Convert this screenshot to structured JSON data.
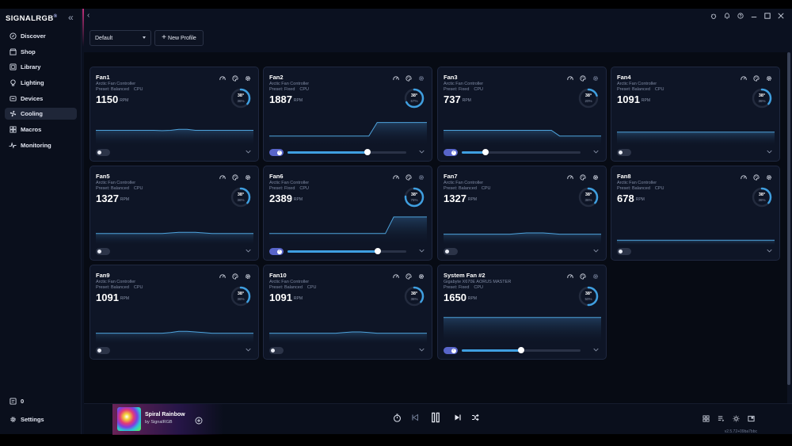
{
  "app": {
    "logo": "SIGNALRGB",
    "logo_mark": "®"
  },
  "sidebar": {
    "items": [
      {
        "label": "Discover",
        "icon": "compass-icon"
      },
      {
        "label": "Shop",
        "icon": "shop-icon"
      },
      {
        "label": "Library",
        "icon": "library-icon"
      },
      {
        "label": "Lighting",
        "icon": "lightbulb-icon"
      },
      {
        "label": "Devices",
        "icon": "devices-icon"
      },
      {
        "label": "Cooling",
        "icon": "fan-icon",
        "active": true
      },
      {
        "label": "Macros",
        "icon": "macros-icon"
      },
      {
        "label": "Monitoring",
        "icon": "pulse-icon"
      }
    ],
    "notifications_count": "0",
    "settings_label": "Settings"
  },
  "toolbar": {
    "profile_value": "Default",
    "new_profile_label": "New Profile"
  },
  "fans": [
    {
      "name": "Fan1",
      "controller": "Arctic Fan Controller",
      "preset": "Preset: Balanced",
      "source": "CPU",
      "rpm": "1150",
      "rpm_unit": "RPM",
      "temp": "38°",
      "percent": "36%",
      "percent_value": 36,
      "manual": false,
      "slider": null,
      "curve": [
        0.46,
        0.46,
        0.46,
        0.46,
        0.46,
        0.46,
        0.46,
        0.46,
        0.47,
        0.46,
        0.43,
        0.43,
        0.46,
        0.46,
        0.46,
        0.46,
        0.46,
        0.46,
        0.46,
        0.46
      ]
    },
    {
      "name": "Fan2",
      "controller": "Arctic Fan Controller",
      "preset": "Preset: Fixed",
      "source": "CPU",
      "rpm": "1887",
      "rpm_unit": "RPM",
      "temp": "38°",
      "percent": "67%",
      "percent_value": 67,
      "manual": true,
      "slider": 0.67,
      "curve": [
        0.65,
        0.65,
        0.65,
        0.65,
        0.65,
        0.65,
        0.65,
        0.65,
        0.65,
        0.65,
        0.65,
        0.65,
        0.65,
        0.2,
        0.2,
        0.2,
        0.2,
        0.2,
        0.2,
        0.2
      ]
    },
    {
      "name": "Fan3",
      "controller": "Arctic Fan Controller",
      "preset": "Preset: Fixed",
      "source": "CPU",
      "rpm": "737",
      "rpm_unit": "RPM",
      "temp": "38°",
      "percent": "20%",
      "percent_value": 20,
      "manual": true,
      "slider": 0.2,
      "curve": [
        0.46,
        0.46,
        0.46,
        0.46,
        0.46,
        0.46,
        0.46,
        0.46,
        0.46,
        0.46,
        0.46,
        0.46,
        0.46,
        0.46,
        0.65,
        0.65,
        0.65,
        0.65,
        0.65,
        0.65
      ]
    },
    {
      "name": "Fan4",
      "controller": "Arctic Fan Controller",
      "preset": "Preset: Balanced",
      "source": "CPU",
      "rpm": "1091",
      "rpm_unit": "RPM",
      "temp": "38°",
      "percent": "36%",
      "percent_value": 36,
      "manual": false,
      "slider": null,
      "curve": [
        0.52,
        0.52,
        0.52,
        0.52,
        0.52,
        0.52,
        0.52,
        0.52,
        0.52,
        0.52,
        0.52,
        0.52,
        0.52,
        0.52,
        0.52,
        0.52,
        0.52,
        0.52,
        0.52,
        0.52
      ]
    },
    {
      "name": "Fan5",
      "controller": "Arctic Fan Controller",
      "preset": "Preset: Balanced",
      "source": "CPU",
      "rpm": "1327",
      "rpm_unit": "RPM",
      "temp": "38°",
      "percent": "36%",
      "percent_value": 36,
      "manual": false,
      "slider": null,
      "curve": [
        0.6,
        0.6,
        0.6,
        0.6,
        0.6,
        0.6,
        0.6,
        0.6,
        0.6,
        0.58,
        0.56,
        0.56,
        0.56,
        0.58,
        0.6,
        0.6,
        0.6,
        0.6,
        0.6,
        0.6
      ]
    },
    {
      "name": "Fan6",
      "controller": "Arctic Fan Controller",
      "preset": "Preset: Fixed",
      "source": "CPU",
      "rpm": "2389",
      "rpm_unit": "RPM",
      "temp": "38°",
      "percent": "76%",
      "percent_value": 76,
      "manual": true,
      "slider": 0.76,
      "curve": [
        0.6,
        0.6,
        0.6,
        0.6,
        0.6,
        0.6,
        0.6,
        0.6,
        0.6,
        0.6,
        0.6,
        0.6,
        0.6,
        0.6,
        0.6,
        0.05,
        0.05,
        0.05,
        0.05,
        0.05
      ]
    },
    {
      "name": "Fan7",
      "controller": "Arctic Fan Controller",
      "preset": "Preset: Balanced",
      "source": "CPU",
      "rpm": "1327",
      "rpm_unit": "RPM",
      "temp": "38°",
      "percent": "36%",
      "percent_value": 36,
      "manual": false,
      "slider": null,
      "curve": [
        0.62,
        0.62,
        0.62,
        0.62,
        0.62,
        0.62,
        0.62,
        0.62,
        0.62,
        0.6,
        0.58,
        0.58,
        0.58,
        0.6,
        0.62,
        0.62,
        0.62,
        0.62,
        0.62,
        0.62
      ]
    },
    {
      "name": "Fan8",
      "controller": "Arctic Fan Controller",
      "preset": "Preset: Balanced",
      "source": "CPU",
      "rpm": "678",
      "rpm_unit": "RPM",
      "temp": "38°",
      "percent": "36%",
      "percent_value": 36,
      "manual": false,
      "slider": null,
      "curve": [
        0.82,
        0.82,
        0.82,
        0.82,
        0.82,
        0.82,
        0.82,
        0.82,
        0.82,
        0.82,
        0.82,
        0.82,
        0.82,
        0.82,
        0.82,
        0.82,
        0.82,
        0.82,
        0.82,
        0.82
      ]
    },
    {
      "name": "Fan9",
      "controller": "Arctic Fan Controller",
      "preset": "Preset: Balanced",
      "source": "CPU",
      "rpm": "1091",
      "rpm_unit": "RPM",
      "temp": "38°",
      "percent": "36%",
      "percent_value": 36,
      "manual": false,
      "slider": null,
      "curve": [
        0.62,
        0.62,
        0.62,
        0.62,
        0.62,
        0.62,
        0.62,
        0.62,
        0.62,
        0.6,
        0.56,
        0.56,
        0.58,
        0.6,
        0.62,
        0.62,
        0.62,
        0.62,
        0.62,
        0.62
      ]
    },
    {
      "name": "Fan10",
      "controller": "Arctic Fan Controller",
      "preset": "Preset: Balanced",
      "source": "CPU",
      "rpm": "1091",
      "rpm_unit": "RPM",
      "temp": "38°",
      "percent": "36%",
      "percent_value": 36,
      "manual": false,
      "slider": null,
      "curve": [
        0.62,
        0.62,
        0.62,
        0.62,
        0.62,
        0.62,
        0.62,
        0.62,
        0.62,
        0.6,
        0.58,
        0.58,
        0.6,
        0.62,
        0.62,
        0.62,
        0.62,
        0.62,
        0.62,
        0.62
      ]
    },
    {
      "name": "System Fan #2",
      "controller": "Gigabyte X670E AORUS MASTER",
      "preset": "Preset: Fixed",
      "source": "CPU",
      "rpm": "1650",
      "rpm_unit": "RPM",
      "temp": "38°",
      "percent": "50%",
      "percent_value": 50,
      "manual": true,
      "slider": 0.5,
      "curve": [
        0.1,
        0.1,
        0.1,
        0.1,
        0.1,
        0.1,
        0.1,
        0.1,
        0.1,
        0.1,
        0.1,
        0.1,
        0.1,
        0.1,
        0.1,
        0.1,
        0.1,
        0.1,
        0.1,
        0.1
      ]
    }
  ],
  "player": {
    "title": "Spiral Rainbow",
    "artist": "by SignalRGB",
    "version": "v2.5.72+09ba7bbc"
  },
  "colors": {
    "accent": "#3f9fe0",
    "toggle_on": "#5865c9",
    "brand_line": "#c0307a"
  }
}
